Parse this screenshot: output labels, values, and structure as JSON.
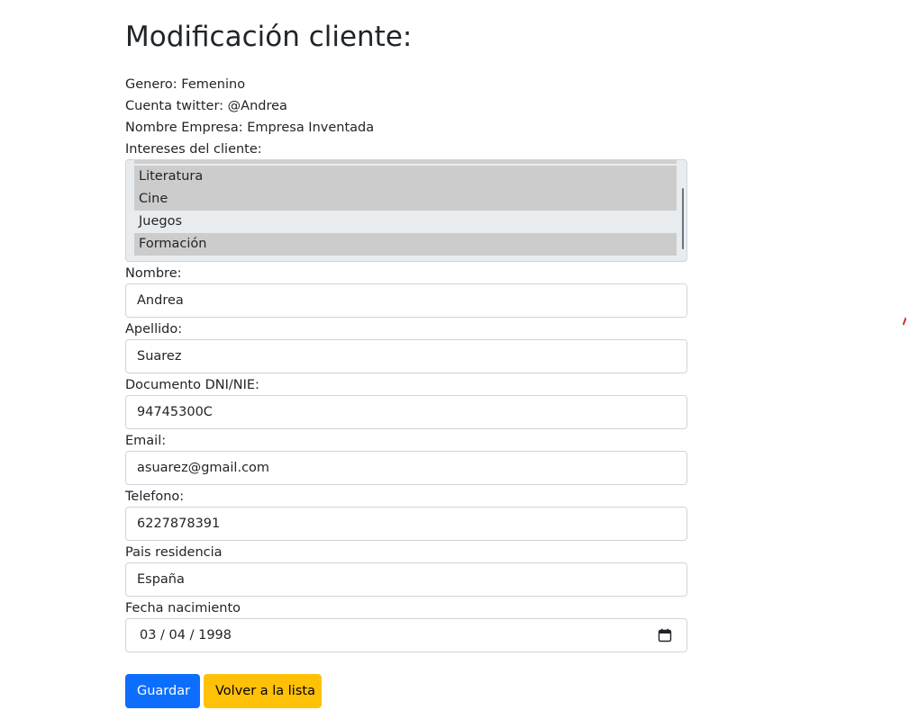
{
  "page": {
    "title": "Modificación cliente:"
  },
  "info": {
    "genero": "Genero: Femenino",
    "twitter": "Cuenta twitter: @Andrea",
    "empresa": "Nombre Empresa: Empresa Inventada",
    "intereses_label": "Intereses del cliente:"
  },
  "intereses": {
    "options": [
      {
        "label": "Literatura",
        "selected": true
      },
      {
        "label": "Cine",
        "selected": true
      },
      {
        "label": "Juegos",
        "selected": false
      },
      {
        "label": "Formación",
        "selected": true
      }
    ]
  },
  "form": {
    "nombre": {
      "label": "Nombre:",
      "value": "Andrea"
    },
    "apellido": {
      "label": "Apellido:",
      "value": "Suarez"
    },
    "documento": {
      "label": "Documento DNI/NIE:",
      "value": "94745300C"
    },
    "email": {
      "label": "Email:",
      "value": "asuarez@gmail.com"
    },
    "telefono": {
      "label": "Telefono:",
      "value": "6227878391"
    },
    "pais": {
      "label": "Pais residencia",
      "value": "España"
    },
    "fecha": {
      "label": "Fecha nacimiento",
      "value": "03 / 04 / 1998",
      "icon": "calendar-icon"
    }
  },
  "actions": {
    "save_label": "Guardar",
    "back_label": "Volver a la lista"
  },
  "colors": {
    "primary": "#0d6efd",
    "warning": "#ffc107",
    "selected_option": "#cccccc",
    "multiselect_bg": "#e9ecef",
    "border": "#ced4da"
  }
}
